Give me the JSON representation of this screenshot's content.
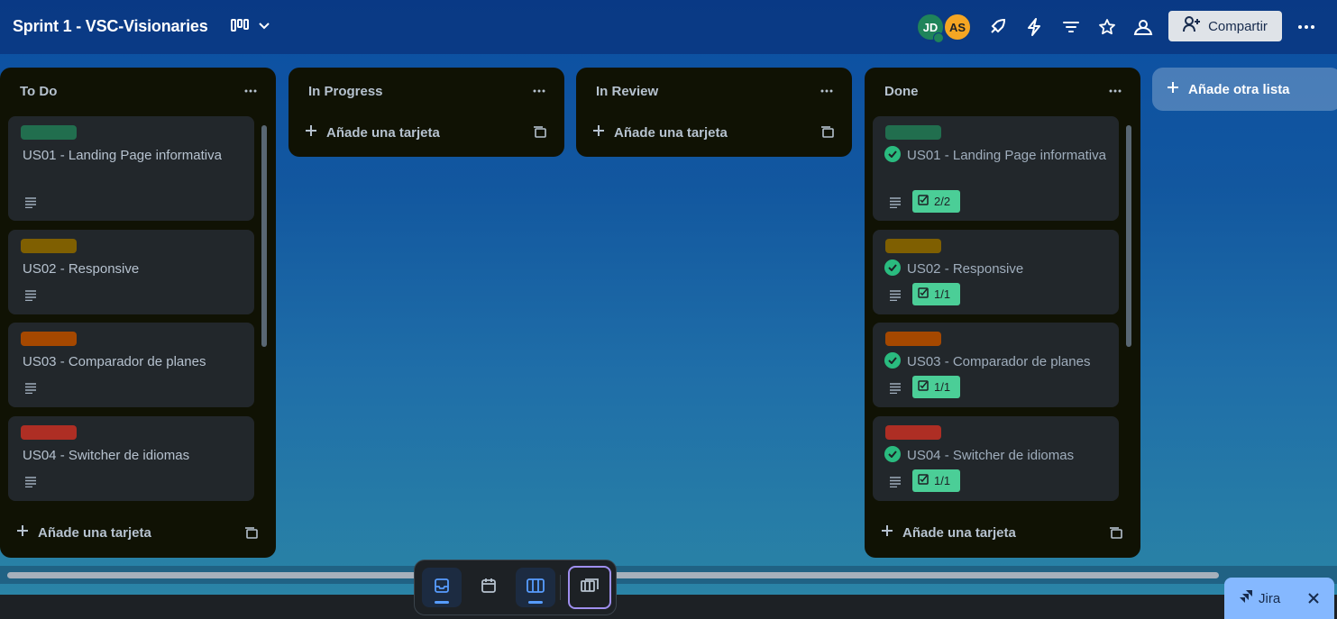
{
  "board": {
    "title": "Sprint 1 - VSC-Visionaries"
  },
  "header": {
    "members": [
      {
        "initials": "JD",
        "color": "#1f845a"
      },
      {
        "initials": "AS",
        "color": "#f5a623"
      }
    ],
    "icons": [
      "power-ups-icon",
      "automation-icon",
      "filter-icon",
      "star-icon",
      "visibility-icon"
    ],
    "share_label": "Compartir",
    "more_icon": "more-icon"
  },
  "lists": [
    {
      "title": "To Do",
      "add_card_label": "Añade una tarjeta",
      "cards": [
        {
          "label_color": "#216e4e",
          "title": "US01 - Landing Page informativa",
          "has_description": true
        },
        {
          "label_color": "#7f5f01",
          "title": "US02 - Responsive",
          "has_description": true
        },
        {
          "label_color": "#a54800",
          "title": "US03 - Comparador de planes",
          "has_description": true
        },
        {
          "label_color": "#ae2e24",
          "title": "US04 - Switcher de idiomas",
          "has_description": true
        }
      ]
    },
    {
      "title": "In Progress",
      "add_card_label": "Añade una tarjeta",
      "cards": []
    },
    {
      "title": "In Review",
      "add_card_label": "Añade una tarjeta",
      "cards": []
    },
    {
      "title": "Done",
      "add_card_label": "Añade una tarjeta",
      "cards": [
        {
          "label_color": "#216e4e",
          "title": "US01 - Landing Page informativa",
          "has_description": true,
          "complete": true,
          "checklist": "2/2"
        },
        {
          "label_color": "#7f5f01",
          "title": "US02 - Responsive",
          "has_description": true,
          "complete": true,
          "checklist": "1/1"
        },
        {
          "label_color": "#a54800",
          "title": "US03 - Comparador de planes",
          "has_description": true,
          "complete": true,
          "checklist": "1/1"
        },
        {
          "label_color": "#ae2e24",
          "title": "US04 - Switcher de idiomas",
          "has_description": true,
          "complete": true,
          "checklist": "1/1"
        }
      ]
    }
  ],
  "add_list_label": "Añade otra lista",
  "dock": {
    "buttons": [
      "inbox-icon",
      "planner-icon",
      "board-icon",
      "switch-board-icon"
    ]
  },
  "jira": {
    "label": "Jira"
  },
  "colors": {
    "list_bg": "#101204",
    "card_bg": "#22272b",
    "done_check": "#2abb7f",
    "checklist_bg": "#4bce97"
  }
}
